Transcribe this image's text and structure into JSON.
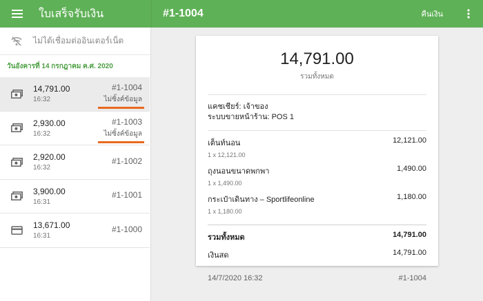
{
  "appbar": {
    "app_title": "ใบเสร็จรับเงิน",
    "receipt_title": "#1-1004",
    "refund_label": "คืนเงิน"
  },
  "sidebar": {
    "offline_text": "ไม่ได้เชื่อมต่ออินเตอร์เน็ต",
    "date_header": "วันอังคารที่ 14 กรกฎาคม ค.ศ. 2020",
    "receipts": [
      {
        "amount": "14,791.00",
        "time": "16:32",
        "number": "#1-1004",
        "sync": "ไม่ซิ้งค์ข้อมูล",
        "icon": "cash-icon"
      },
      {
        "amount": "2,930.00",
        "time": "16:32",
        "number": "#1-1003",
        "sync": "ไม่ซิ้งค์ข้อมูล",
        "icon": "cash-icon"
      },
      {
        "amount": "2,920.00",
        "time": "16:32",
        "number": "#1-1002",
        "sync": "",
        "icon": "cash-icon"
      },
      {
        "amount": "3,900.00",
        "time": "16:31",
        "number": "#1-1001",
        "sync": "",
        "icon": "cash-icon"
      },
      {
        "amount": "13,671.00",
        "time": "16:31",
        "number": "#1-1000",
        "sync": "",
        "icon": "card-icon"
      }
    ]
  },
  "receipt": {
    "total": "14,791.00",
    "total_caption": "รวมทั้งหมด",
    "cashier": "แคชเชียร์: เจ้าของ",
    "pos": "ระบบขายหน้าร้าน: POS 1",
    "items": [
      {
        "name": "เต็นท์นอน",
        "qty": "1 x 12,121.00",
        "price": "12,121.00"
      },
      {
        "name": "ถุงนอนขนาดพกพา",
        "qty": "1 x 1,490.00",
        "price": "1,490.00"
      },
      {
        "name": "กระเป๋าเดินทาง – Sportlifeonline",
        "qty": "1 x 1,180.00",
        "price": "1,180.00"
      }
    ],
    "total_label": "รวมทั้งหมด",
    "total_value": "14,791.00",
    "cash_label": "เงินสด",
    "cash_value": "14,791.00",
    "datetime": "14/7/2020 16:32",
    "number": "#1-1004"
  },
  "colors": {
    "appbar": "#5fb157",
    "accent_green": "#4c9f43",
    "highlight_underline": "#e8691f"
  }
}
